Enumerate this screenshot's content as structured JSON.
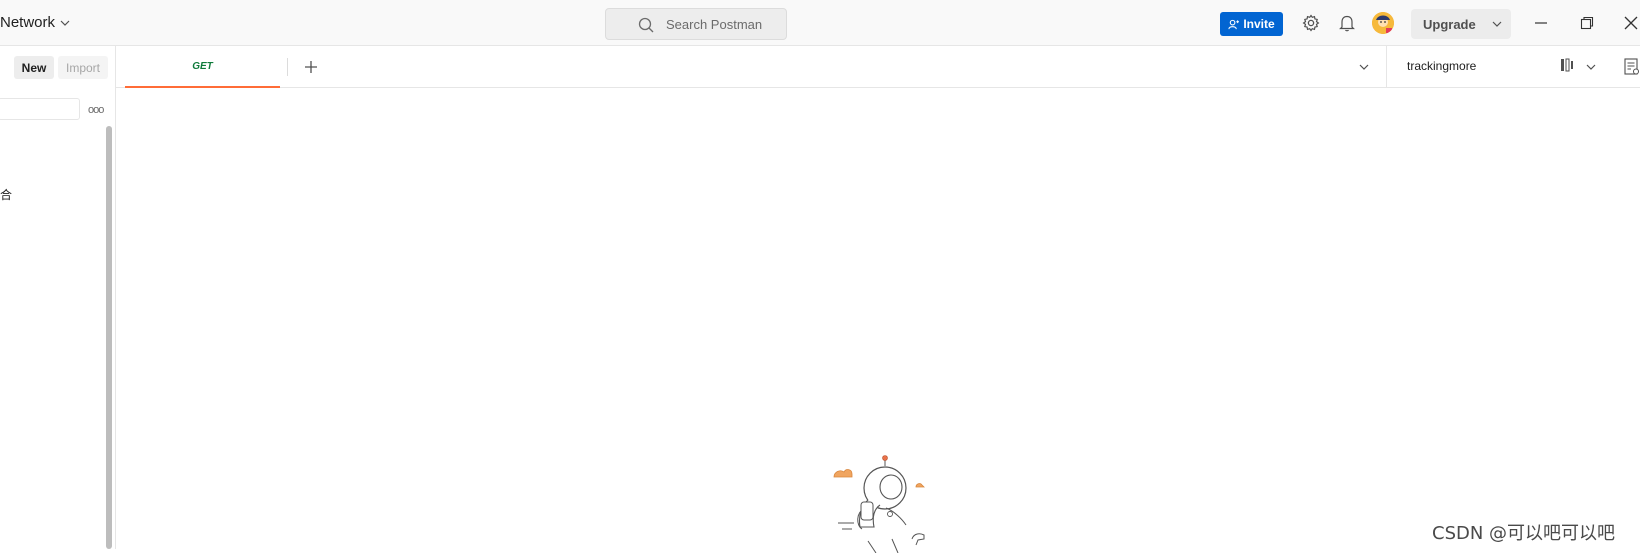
{
  "header": {
    "workspace_label": "Network",
    "search_placeholder": "Search Postman",
    "invite_label": "Invite",
    "upgrade_label": "Upgrade",
    "icons": [
      "search-icon",
      "invite-user-icon",
      "gear-icon",
      "bell-icon",
      "avatar",
      "chevron-down-icon",
      "minimize-icon",
      "restore-icon",
      "close-icon"
    ]
  },
  "sidebar": {
    "new_label": "New",
    "import_label": "Import",
    "more_label": "ooo",
    "item_fragment": "合"
  },
  "tabs": {
    "items": [
      {
        "method": "GET",
        "title": ""
      }
    ],
    "environment": "trackingmore"
  },
  "watermark": "CSDN @可以吧可以吧",
  "colors": {
    "accent_orange": "#ff6c37",
    "invite_blue": "#0265d2",
    "get_green": "#0f7b3b",
    "header_bg": "#f9f9f9"
  }
}
